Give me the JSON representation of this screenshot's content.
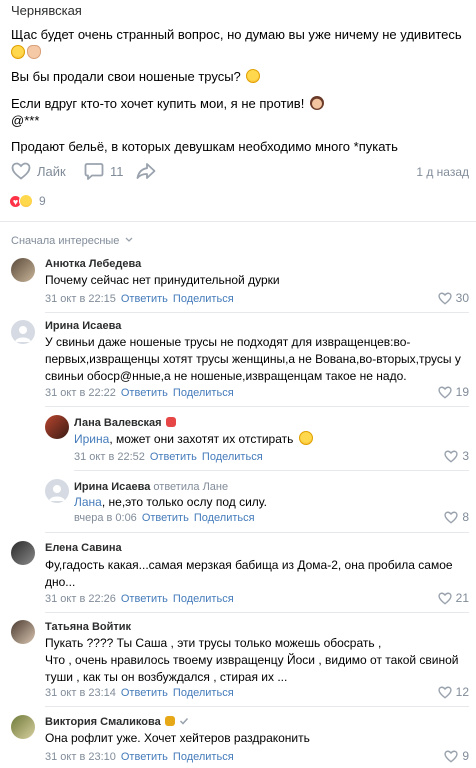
{
  "post": {
    "author": "Чернявская",
    "lines": [
      "Щас будет очень странный вопрос, но думаю вы уже ничему не удивитесь",
      "Вы бы продали свои ношеные трусы?",
      "Если вдруг кто-то хочет купить мои, я не против!",
      "@***",
      "Продают бельё, в которых девушкам необходимо много *пукать"
    ],
    "like_label": "Лайк",
    "comments_count": "11",
    "time_ago": "1 д назад",
    "reactions_count": "9",
    "colors": {
      "accent": "#447bba",
      "muted": "#818c99",
      "heart": "#ff3347"
    }
  },
  "comments_header": {
    "sort_label": "Сначала интересные"
  },
  "actions": {
    "reply": "Ответить",
    "share": "Поделиться"
  },
  "comments": [
    {
      "author": "Анютка Лебедева",
      "text": [
        "Почему сейчас нет принудительной дурки"
      ],
      "date": "31 окт в 22:15",
      "likes": "30"
    },
    {
      "author": "Ирина Исаева",
      "text": [
        "У свиньи даже ношеные трусы не подходят для извращенцев:во-",
        "первых,извращенцы хотят трусы женщины,а не Вована,во-вторых,трусы у",
        "свиньи обоср@нные,а не ношеные,извращенцам такое не надо."
      ],
      "date": "31 окт в 22:22",
      "likes": "19"
    },
    {
      "author": "Лана Валевская",
      "reply_to": "Ирина",
      "text": [
        ", может они захотят их отстирать"
      ],
      "date": "31 окт в 22:52",
      "likes": "3"
    },
    {
      "author": "Ирина Исаева",
      "answered": "ответила Лане",
      "reply_to": "Лана",
      "text": [
        ", не,это только ослу под силу."
      ],
      "date": "вчера в 0:06",
      "likes": "8"
    },
    {
      "author": "Елена Савина",
      "text": [
        "Фу,гадость какая...самая мерзкая бабища из Дома-2, она пробила самое",
        "дно..."
      ],
      "date": "31 окт в 22:26",
      "likes": "21"
    },
    {
      "author": "Татьяна Войтик",
      "text": [
        "Пукать ???? Ты Саша , эти трусы только можешь обосрать ,",
        "Что , очень нравилось твоему извращенцу Йоси , видимо от такой свиной",
        "туши , как ты он возбуждался , стирая их ..."
      ],
      "date": "31 окт в 23:14",
      "likes": "12"
    },
    {
      "author": "Виктория Смаликова",
      "text": [
        "Она рофлит уже. Хочет хейтеров раздраконить"
      ],
      "date": "31 окт в 23:10",
      "likes": "9"
    }
  ]
}
